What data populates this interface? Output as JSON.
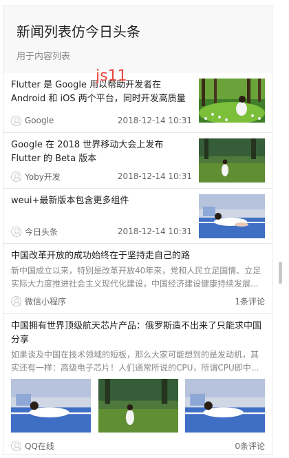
{
  "header": {
    "title": "新闻列表仿今日头条",
    "desc": "用于内容列表"
  },
  "overlay_text": "js11",
  "news": [
    {
      "title": "Flutter 是 Google 用以帮助开发者在 Android 和 iOS 两个平台，同时开发高质量原生应...",
      "source": "Google",
      "time": "2018-12-14 10:31",
      "image": "girl-in-grass"
    },
    {
      "title": "Google 在 2018 世界移动大会上发布 Flutter 的 Beta 版本",
      "source": "Yoby开发",
      "time": "2018-12-14 10:31",
      "image": "girl-in-field"
    },
    {
      "title": "weui+最新版本包含更多组件",
      "source": "今日头条",
      "time": "2018-12-14 10:31",
      "image": "girl-on-court"
    }
  ],
  "articles": [
    {
      "title": "中国改革开放的成功始终在于坚持走自己的路",
      "desc": "新中国成立以来，特别是改革开放40年来，党和人民立足国情、立足实际大力度推进社会主义现代化建设，中国经济建设健康持续发展...",
      "source": "微信小程序",
      "comments": "1条评论"
    },
    {
      "title": "中国拥有世界顶级航天芯片产品：俄罗斯造不出来了只能求中国分享",
      "desc": "如果谈及中国在技术领域的短板，那么大家可能想到的是发动机，其实还有一样：高级电子芯片！人们通常所说的CPU，所谓CPU即中...",
      "source": "QQ在线",
      "comments": "0条评论",
      "images": [
        "girl-on-court",
        "girl-in-field",
        "girl-on-court"
      ]
    }
  ]
}
